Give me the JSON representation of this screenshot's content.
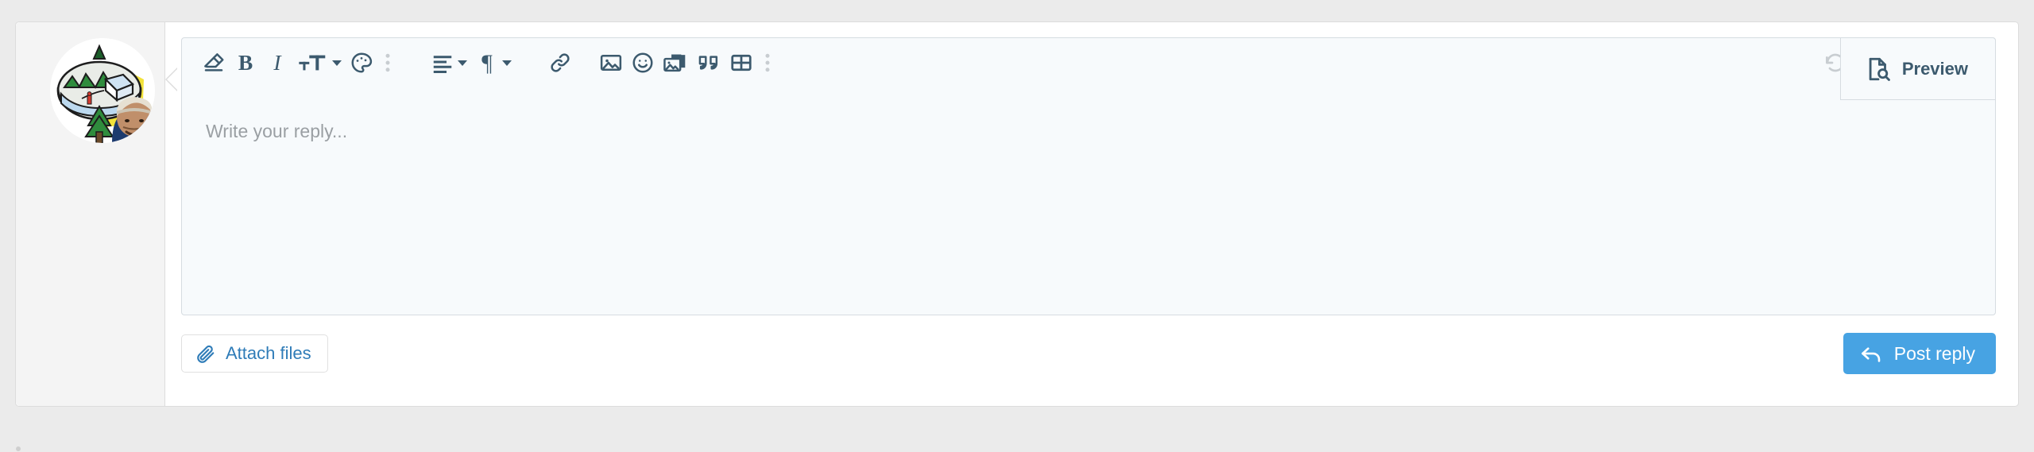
{
  "panel": {
    "name": "reply-composer"
  },
  "avatar": {
    "alt": "user-avatar-mountain-landscape"
  },
  "editor": {
    "placeholder": "Write your reply...",
    "value": "",
    "preview_tab_label": "Preview"
  },
  "toolbar": {
    "groups": [
      {
        "name": "formatting",
        "buttons": [
          {
            "name": "clear-formatting-icon",
            "icon": "eraser",
            "label": "",
            "dimmed": false,
            "caret": false
          },
          {
            "name": "bold-button",
            "icon": "bold",
            "label": "B",
            "dimmed": false,
            "caret": false
          },
          {
            "name": "italic-button",
            "icon": "italic",
            "label": "I",
            "dimmed": false,
            "caret": false
          },
          {
            "name": "text-size-button",
            "icon": "text-size",
            "label": "",
            "dimmed": false,
            "caret": true
          },
          {
            "name": "text-color-button",
            "icon": "palette",
            "label": "",
            "dimmed": false,
            "caret": false
          },
          {
            "name": "more-formatting-button",
            "icon": "vertical-dots",
            "label": "",
            "dimmed": true,
            "caret": false
          }
        ]
      },
      {
        "name": "paragraph",
        "buttons": [
          {
            "name": "align-button",
            "icon": "align-left",
            "label": "",
            "dimmed": false,
            "caret": true
          },
          {
            "name": "paragraph-style-button",
            "icon": "pilcrow",
            "label": "",
            "dimmed": false,
            "caret": true
          }
        ]
      },
      {
        "name": "insert",
        "buttons": [
          {
            "name": "link-button",
            "icon": "link",
            "label": "",
            "dimmed": false,
            "caret": false
          },
          {
            "name": "insert-image-button",
            "icon": "image",
            "label": "",
            "dimmed": false,
            "caret": false
          },
          {
            "name": "emoji-button",
            "icon": "smiley",
            "label": "",
            "dimmed": false,
            "caret": false
          },
          {
            "name": "insert-gallery-button",
            "icon": "gallery",
            "label": "",
            "dimmed": false,
            "caret": false
          },
          {
            "name": "blockquote-button",
            "icon": "quote",
            "label": "",
            "dimmed": false,
            "caret": false
          },
          {
            "name": "insert-table-button",
            "icon": "table",
            "label": "",
            "dimmed": false,
            "caret": false
          },
          {
            "name": "more-insert-button",
            "icon": "vertical-dots",
            "label": "",
            "dimmed": true,
            "caret": false
          }
        ]
      }
    ],
    "right_buttons": [
      {
        "name": "undo-button",
        "icon": "undo",
        "dimmed": true,
        "caret": false
      },
      {
        "name": "redo-button",
        "icon": "redo",
        "dimmed": true,
        "caret": false
      },
      {
        "name": "insert-brackets-button",
        "icon": "brackets",
        "dimmed": false,
        "caret": false
      },
      {
        "name": "save-draft-button",
        "icon": "floppy-disk",
        "dimmed": false,
        "caret": true
      }
    ]
  },
  "footer": {
    "attach_label": "Attach files",
    "post_label": "Post reply"
  },
  "colors": {
    "page_background": "#ebebeb",
    "panel_background": "#ffffff",
    "gutter_background": "#f4f4f4",
    "editor_background": "#f7fafc",
    "toolbar_icon": "#3c5a6e",
    "toolbar_icon_disabled": "#c8cdd1",
    "link_blue": "#2f7cb8",
    "primary_button": "#47a3e3",
    "placeholder_text": "#9a9fa3",
    "border": "#d6dce1"
  }
}
